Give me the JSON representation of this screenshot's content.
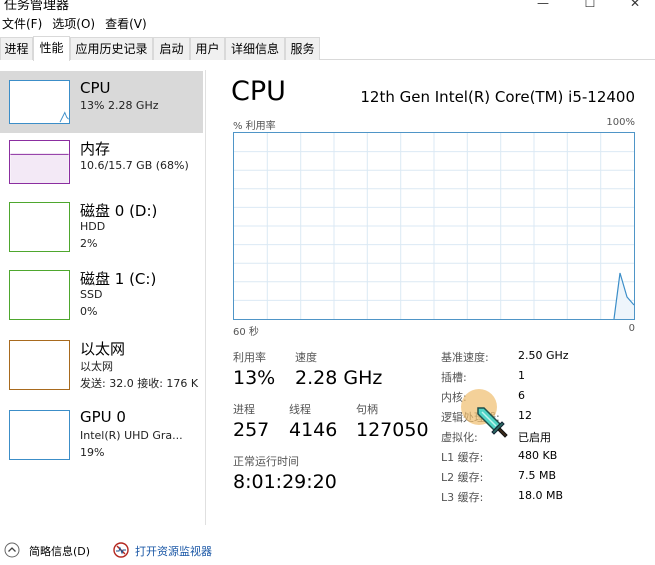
{
  "window": {
    "title": "任务管理器",
    "minimize": "—",
    "maximize": "☐",
    "close": "✕"
  },
  "menu": [
    "文件(F)",
    "选项(O)",
    "查看(V)"
  ],
  "tabs": [
    "进程",
    "性能",
    "应用历史记录",
    "启动",
    "用户",
    "详细信息",
    "服务"
  ],
  "active_tab": "性能",
  "sidebar": {
    "items": [
      {
        "title": "CPU",
        "line1": "13%  2.28 GHz",
        "line2": "",
        "line3": "",
        "color": "#3c8ec8",
        "selected": true
      },
      {
        "title": "内存",
        "line1": "10.6/15.7 GB (68%)",
        "line2": "",
        "line3": "",
        "color": "#8b2ea0"
      },
      {
        "title": "磁盘 0 (D:)",
        "line1": "HDD",
        "line2": "2%",
        "line3": "",
        "color": "#4ea72e"
      },
      {
        "title": "磁盘 1 (C:)",
        "line1": "SSD",
        "line2": "0%",
        "line3": "",
        "color": "#4ea72e"
      },
      {
        "title": "以太网",
        "line1": "以太网",
        "line2": "发送: 32.0  接收: 176 K",
        "line3": "",
        "color": "#a86a1e"
      },
      {
        "title": "GPU 0",
        "line1": "Intel(R) UHD Gra...",
        "line2": "19%",
        "line3": "",
        "color": "#3c8ec8"
      }
    ]
  },
  "main": {
    "title": "CPU",
    "model": "12th Gen Intel(R) Core(TM) i5-12400",
    "util_label": "% 利用率",
    "util_max": "100%",
    "time_left": "60 秒",
    "time_right": "0",
    "graph_color": "#3c8ec8",
    "stats": {
      "util_label": "利用率",
      "util_value": "13%",
      "speed_label": "速度",
      "speed_value": "2.28 GHz",
      "proc_label": "进程",
      "proc_value": "257",
      "threads_label": "线程",
      "threads_value": "4146",
      "handles_label": "句柄",
      "handles_value": "127050",
      "uptime_label": "正常运行时间",
      "uptime_value": "8:01:29:20"
    },
    "details": [
      {
        "label": "基准速度:",
        "value": "2.50 GHz"
      },
      {
        "label": "插槽:",
        "value": "1"
      },
      {
        "label": "内核:",
        "value": "6"
      },
      {
        "label": "逻辑处理器:",
        "value": "12"
      },
      {
        "label": "虚拟化:",
        "value": "已启用"
      },
      {
        "label": "L1 缓存:",
        "value": "480 KB"
      },
      {
        "label": "L2 缓存:",
        "value": "7.5 MB"
      },
      {
        "label": "L3 缓存:",
        "value": "18.0 MB"
      }
    ]
  },
  "footer": {
    "summary": "简略信息(D)",
    "resmon": "打开资源监视器"
  }
}
